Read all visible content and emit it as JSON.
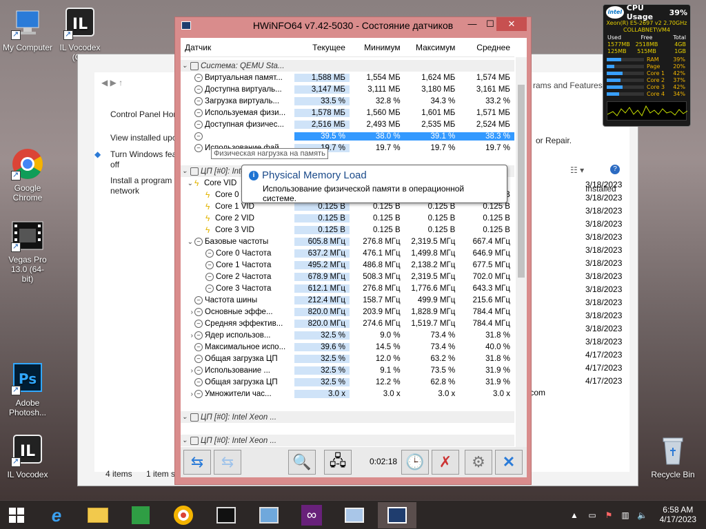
{
  "desktop": {
    "icons": [
      {
        "label": "My Computer"
      },
      {
        "label": "IL Vocodex (C..."
      },
      {
        "label": "Google Chrome"
      },
      {
        "label": "Vegas Pro 13.0 (64-bit)"
      },
      {
        "label": "Adobe Photosh..."
      },
      {
        "label": "IL Vocodex"
      },
      {
        "label": "Recycle Bin"
      }
    ]
  },
  "explorer": {
    "cp_home": "Control Panel Hor",
    "view_updates": "View installed upc",
    "turn_features": "Turn Windows fea",
    "turn_features2": "off",
    "install_program": "Install a program f",
    "install_program2": "network",
    "right_text": "rams and Features",
    "repair_text": "or Repair.",
    "col_installed": "Installed",
    "dates": [
      "3/18/2023",
      "3/18/2023",
      "3/18/2023",
      "3/18/2023",
      "3/18/2023",
      "3/18/2023",
      "3/18/2023",
      "3/18/2023",
      "3/18/2023",
      "3/18/2023",
      "3/18/2023",
      "3/18/2023",
      "3/18/2023",
      "4/17/2023",
      "4/17/2023",
      "4/17/2023"
    ],
    "ms_labels": [
      "n",
      "n",
      "n",
      "n",
      "n",
      "n",
      "n",
      "n",
      "n",
      "n",
      ".com"
    ],
    "status_items": "4 items",
    "status_selected": "1 item s"
  },
  "gadget": {
    "title": "CPU Usage",
    "cpu_pct": "39%",
    "cpu_model": "Xeon(R) E5-2697 v2 2.70GHz",
    "host": "COLLABNET\\VM4",
    "mem_head": [
      "Used",
      "Free",
      "Total"
    ],
    "mem_row1": [
      "1577MB",
      "2518MB",
      "4GB"
    ],
    "mem_row2": [
      "125MB",
      "515MB",
      "1GB"
    ],
    "bars": [
      {
        "label": "RAM",
        "pct": "39%",
        "value": 39
      },
      {
        "label": "Page",
        "pct": "20%",
        "value": 20
      },
      {
        "label": "Core 1",
        "pct": "42%",
        "value": 42
      },
      {
        "label": "Core 2",
        "pct": "37%",
        "value": 37
      },
      {
        "label": "Core 3",
        "pct": "42%",
        "value": 42
      },
      {
        "label": "Core 4",
        "pct": "34%",
        "value": 34
      }
    ]
  },
  "hwinfo": {
    "title": "HWiNFO64 v7.42-5030 - Состояние датчиков",
    "columns": [
      "Датчик",
      "Текущее",
      "Минимум",
      "Максимум",
      "Среднее"
    ],
    "tooltip": "Физическая нагрузка на память",
    "balloon_title": "Physical Memory Load",
    "balloon_text": "Использование физической памяти в операционной системе.",
    "timer": "0:02:18",
    "rows": [
      {
        "t": "group",
        "name": "Система: QEMU Sta..."
      },
      {
        "t": "r",
        "ic": "c",
        "name": "Виртуальная памят...",
        "v": [
          "1,588 МБ",
          "1,554 МБ",
          "1,624 МБ",
          "1,574 МБ"
        ]
      },
      {
        "t": "r",
        "ic": "c",
        "name": "Доступна виртуаль...",
        "v": [
          "3,147 МБ",
          "3,111 МБ",
          "3,180 МБ",
          "3,161 МБ"
        ]
      },
      {
        "t": "r",
        "ic": "c",
        "name": "Загрузка виртуаль...",
        "v": [
          "33.5 %",
          "32.8 %",
          "34.3 %",
          "33.2 %"
        ]
      },
      {
        "t": "r",
        "ic": "c",
        "name": "Используемая физи...",
        "v": [
          "1,578 МБ",
          "1,560 МБ",
          "1,601 МБ",
          "1,571 МБ"
        ]
      },
      {
        "t": "r",
        "ic": "c",
        "name": "Доступная физичес...",
        "v": [
          "2,516 МБ",
          "2,493 МБ",
          "2,535 МБ",
          "2,524 МБ"
        ]
      },
      {
        "t": "sel",
        "ic": "c",
        "name": "",
        "v": [
          "39.5 %",
          "38.0 %",
          "39.1 %",
          "38.3 %"
        ]
      },
      {
        "t": "r",
        "ic": "c",
        "name": "Использование фай...",
        "v": [
          "19.7 %",
          "19.7 %",
          "19.7 %",
          "19.7 %"
        ]
      },
      {
        "t": "blank"
      },
      {
        "t": "group",
        "name": "ЦП [#0]: Intel Xeon ..."
      },
      {
        "t": "r",
        "ic": "b",
        "chev": "v",
        "name": "Core VID",
        "v": [
          "",
          "",
          "",
          ""
        ]
      },
      {
        "t": "r",
        "ic": "b",
        "indent": 1,
        "name": "Core 0 VID",
        "v": [
          "0.125 В",
          "0.125 В",
          "0.125 В",
          "0.125 В"
        ]
      },
      {
        "t": "r",
        "ic": "b",
        "indent": 1,
        "name": "Core 1 VID",
        "v": [
          "0.125 В",
          "0.125 В",
          "0.125 В",
          "0.125 В"
        ]
      },
      {
        "t": "r",
        "ic": "b",
        "indent": 1,
        "name": "Core 2 VID",
        "v": [
          "0.125 В",
          "0.125 В",
          "0.125 В",
          "0.125 В"
        ]
      },
      {
        "t": "r",
        "ic": "b",
        "indent": 1,
        "name": "Core 3 VID",
        "v": [
          "0.125 В",
          "0.125 В",
          "0.125 В",
          "0.125 В"
        ]
      },
      {
        "t": "r",
        "ic": "c",
        "chev": "v",
        "name": "Базовые частоты",
        "v": [
          "605.8 МГц",
          "276.8 МГц",
          "2,319.5 МГц",
          "667.4 МГц"
        ]
      },
      {
        "t": "r",
        "ic": "c",
        "indent": 1,
        "name": "Core 0 Частота",
        "v": [
          "637.2 МГц",
          "476.1 МГц",
          "1,499.8 МГц",
          "646.9 МГц"
        ]
      },
      {
        "t": "r",
        "ic": "c",
        "indent": 1,
        "name": "Core 1 Частота",
        "v": [
          "495.2 МГц",
          "486.8 МГц",
          "2,138.2 МГц",
          "677.5 МГц"
        ]
      },
      {
        "t": "r",
        "ic": "c",
        "indent": 1,
        "name": "Core 2 Частота",
        "v": [
          "678.9 МГц",
          "508.3 МГц",
          "2,319.5 МГц",
          "702.0 МГц"
        ]
      },
      {
        "t": "r",
        "ic": "c",
        "indent": 1,
        "name": "Core 3 Частота",
        "v": [
          "612.1 МГц",
          "276.8 МГц",
          "1,776.6 МГц",
          "643.3 МГц"
        ]
      },
      {
        "t": "r",
        "ic": "c",
        "name": "Частота шины",
        "v": [
          "212.4 МГц",
          "158.7 МГц",
          "499.9 МГц",
          "215.6 МГц"
        ]
      },
      {
        "t": "r",
        "ic": "c",
        "chev": ">",
        "name": "Основные эффе...",
        "v": [
          "820.0 МГц",
          "203.9 МГц",
          "1,828.9 МГц",
          "784.4 МГц"
        ]
      },
      {
        "t": "r",
        "ic": "c",
        "name": "Средняя эффектив...",
        "v": [
          "820.0 МГц",
          "274.6 МГц",
          "1,519.7 МГц",
          "784.4 МГц"
        ]
      },
      {
        "t": "r",
        "ic": "c",
        "chev": ">",
        "name": "Ядер использов...",
        "v": [
          "32.5 %",
          "9.0 %",
          "73.4 %",
          "31.8 %"
        ]
      },
      {
        "t": "r",
        "ic": "c",
        "name": "Максимальное испо...",
        "v": [
          "39.6 %",
          "14.5 %",
          "73.4 %",
          "40.0 %"
        ]
      },
      {
        "t": "r",
        "ic": "c",
        "name": "Общая загрузка ЦП",
        "v": [
          "32.5 %",
          "12.0 %",
          "63.2 %",
          "31.8 %"
        ]
      },
      {
        "t": "r",
        "ic": "c",
        "chev": ">",
        "name": "Использование ...",
        "v": [
          "32.5 %",
          "9.1 %",
          "73.5 %",
          "31.9 %"
        ]
      },
      {
        "t": "r",
        "ic": "c",
        "name": "Общая загрузка ЦП",
        "v": [
          "32.5 %",
          "12.2 %",
          "62.8 %",
          "31.9 %"
        ]
      },
      {
        "t": "r",
        "ic": "c",
        "chev": ">",
        "name": "Умножители час...",
        "v": [
          "3.0 x",
          "3.0 x",
          "3.0 x",
          "3.0 x"
        ]
      },
      {
        "t": "blank"
      },
      {
        "t": "group",
        "name": "ЦП [#0]: Intel Xeon ..."
      },
      {
        "t": "blank"
      },
      {
        "t": "group",
        "name": "ЦП [#0]: Intel Xeon ..."
      }
    ]
  },
  "taskbar": {
    "time": "6:58 AM",
    "date": "4/17/2023"
  }
}
